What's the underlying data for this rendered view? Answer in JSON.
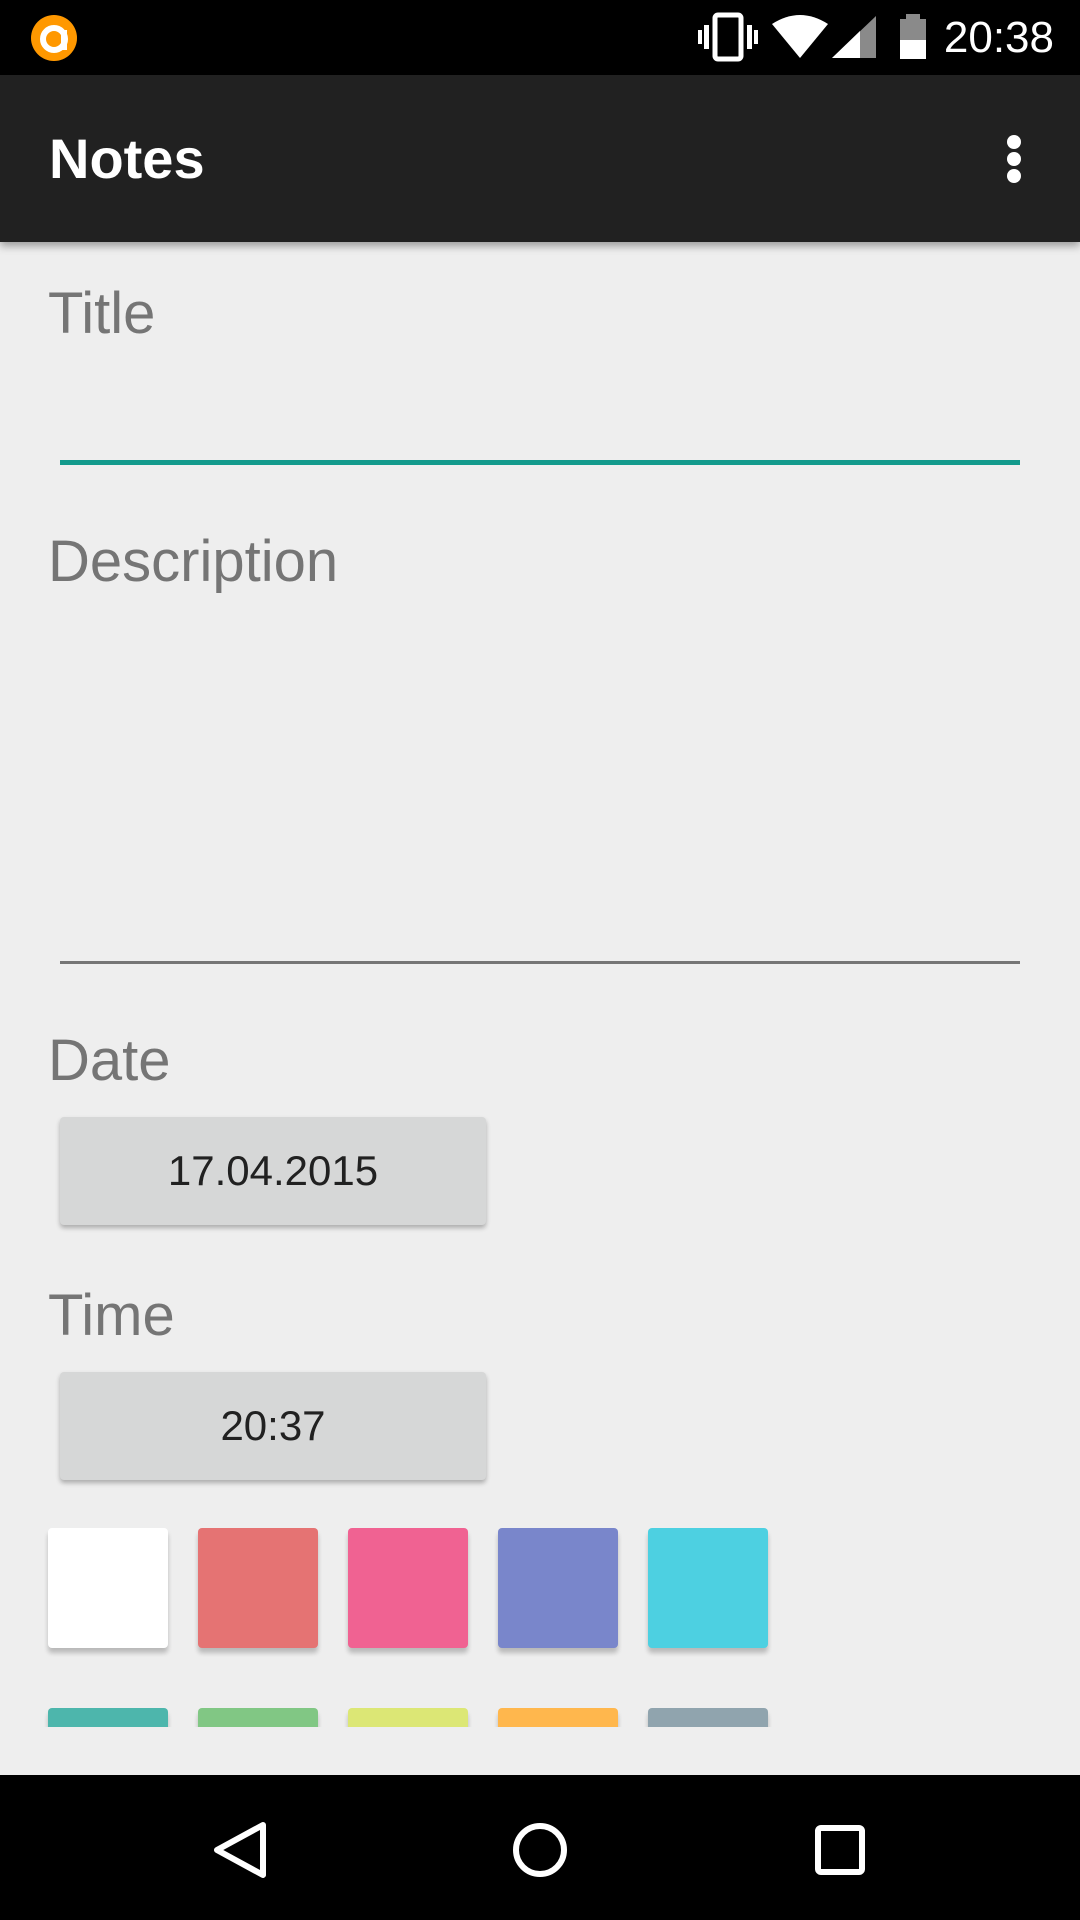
{
  "status_bar": {
    "time": "20:38",
    "icons": [
      "app-notification-icon",
      "vibrate-icon",
      "wifi-icon",
      "cell-signal-icon",
      "battery-icon"
    ]
  },
  "app_bar": {
    "title": "Notes",
    "menu_icon": "more-vert-icon"
  },
  "form": {
    "title_label": "Title",
    "title_value": "",
    "description_label": "Description",
    "description_value": "",
    "date_label": "Date",
    "date_value": "17.04.2015",
    "time_label": "Time",
    "time_value": "20:37"
  },
  "colors": {
    "accent": "#139a8c",
    "app_bar": "#212121",
    "background": "#eeeeee",
    "swatches": [
      "#ffffff",
      "#e57373",
      "#f06292",
      "#7986cb",
      "#4dd0e1",
      "#4db6ac",
      "#81c784",
      "#dce775",
      "#ffb74d",
      "#90a4ae"
    ]
  },
  "nav_bar": {
    "icons": [
      "back-icon",
      "home-icon",
      "recents-icon"
    ]
  }
}
